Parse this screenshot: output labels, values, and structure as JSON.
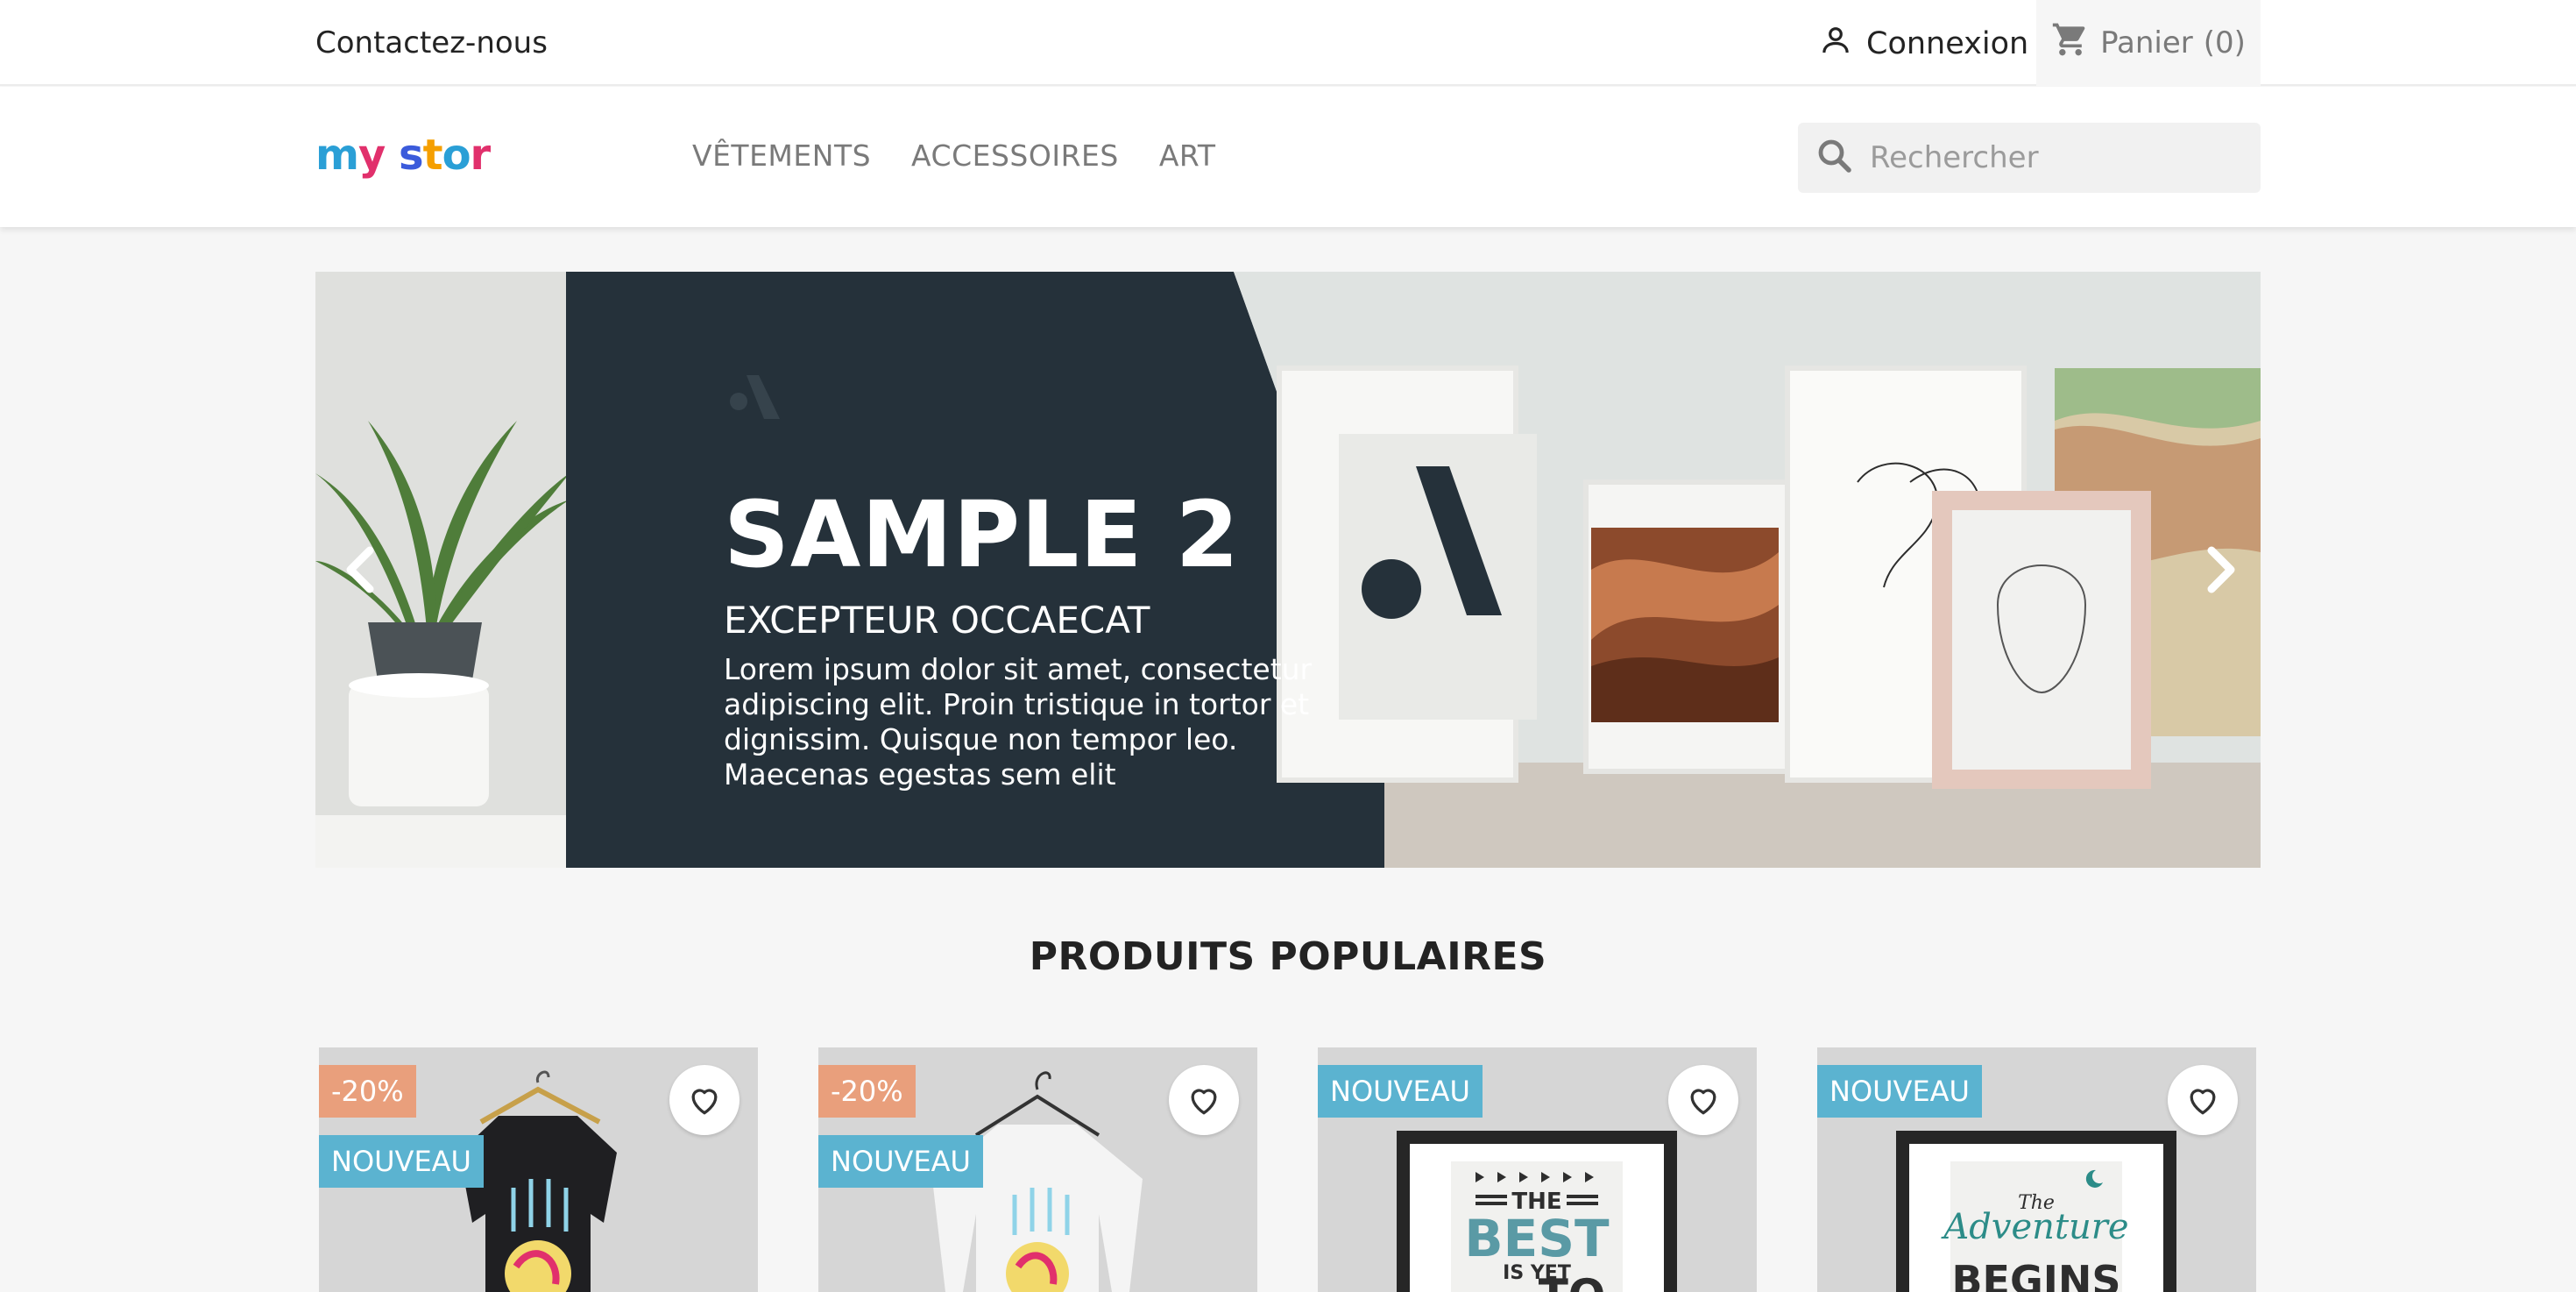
{
  "topbar": {
    "contact": "Contactez-nous",
    "signin": "Connexion",
    "cart_label": "Panier",
    "cart_count": "(0)"
  },
  "header": {
    "logo_text": "my store",
    "nav": [
      "VÊTEMENTS",
      "ACCESSOIRES",
      "ART"
    ],
    "search_placeholder": "Rechercher"
  },
  "carousel": {
    "title": "SAMPLE 2",
    "subtitle": "EXCEPTEUR OCCAECAT",
    "description": "Lorem ipsum dolor sit amet, consectetur adipiscing elit. Proin tristique in tortor et dignissim. Quisque non tempor leo. Maecenas egestas sem elit"
  },
  "popular": {
    "title": "PRODUITS POPULAIRES",
    "products": [
      {
        "discount": "-20%",
        "flag": "NOUVEAU"
      },
      {
        "discount": "-20%",
        "flag": "NOUVEAU"
      },
      {
        "flag": "NOUVEAU"
      },
      {
        "flag": "NOUVEAU"
      }
    ]
  },
  "colors": {
    "accent_new": "#5bb3d0",
    "accent_discount": "#e99f7c",
    "slide_dark": "#25313a"
  },
  "icons": [
    "person-icon",
    "cart-icon",
    "search-icon",
    "chevron-left-icon",
    "chevron-right-icon",
    "heart-icon"
  ]
}
